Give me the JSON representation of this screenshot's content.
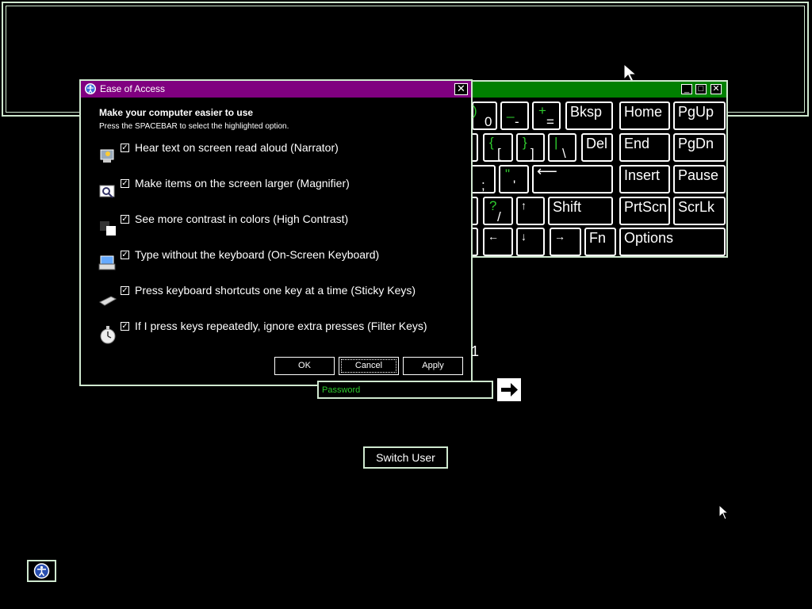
{
  "background": {
    "color": "#000000",
    "frame_color": "#cfe8cf"
  },
  "osk": {
    "title_color": "#008000",
    "controls": {
      "minimize": "_",
      "maximize": "□",
      "close": "✕"
    },
    "keys": {
      "row1": [
        {
          "id": "zero",
          "top": ")",
          "bottom": "0"
        },
        {
          "id": "minus",
          "top": "_",
          "bottom": "-"
        },
        {
          "id": "equals",
          "top": "+",
          "bottom": "="
        },
        {
          "id": "bksp",
          "label": "Bksp"
        },
        {
          "id": "home",
          "label": "Home"
        },
        {
          "id": "pgup",
          "label": "PgUp"
        }
      ],
      "row2": [
        {
          "id": "lbracket",
          "top": "{",
          "bottom": "["
        },
        {
          "id": "rbracket",
          "top": "}",
          "bottom": "]"
        },
        {
          "id": "backslash",
          "top": "|",
          "bottom": "\\"
        },
        {
          "id": "del",
          "label": "Del"
        },
        {
          "id": "end",
          "label": "End"
        },
        {
          "id": "pgdn",
          "label": "PgDn"
        }
      ],
      "row3": [
        {
          "id": "semicolon",
          "bottom": ";"
        },
        {
          "id": "quote",
          "top": "\"",
          "bottom": "'"
        },
        {
          "id": "enter",
          "label": "⟵"
        },
        {
          "id": "insert",
          "label": "Insert"
        },
        {
          "id": "pause",
          "label": "Pause"
        }
      ],
      "row4": [
        {
          "id": "slash",
          "top": "?",
          "bottom": "/"
        },
        {
          "id": "up",
          "label": "↑"
        },
        {
          "id": "shift",
          "label": "Shift"
        },
        {
          "id": "prtscn",
          "label": "PrtScn"
        },
        {
          "id": "scrlk",
          "label": "ScrLk"
        }
      ],
      "row5": [
        {
          "id": "left",
          "label": "←"
        },
        {
          "id": "down",
          "label": "↓"
        },
        {
          "id": "right",
          "label": "→"
        },
        {
          "id": "fn",
          "label": "Fn"
        },
        {
          "id": "options",
          "label": "Options"
        }
      ]
    }
  },
  "eoa_dialog": {
    "title": "Ease of Access",
    "title_color": "#800080",
    "close": "✕",
    "heading": "Make your computer easier to use",
    "subheading": "Press the SPACEBAR to select the highlighted option.",
    "options": [
      {
        "label": "Hear text on screen read aloud (Narrator)",
        "checked": true,
        "icon": "narrator-icon"
      },
      {
        "label": "Make items on the screen larger (Magnifier)",
        "checked": true,
        "icon": "magnifier-icon"
      },
      {
        "label": "See more contrast in colors (High Contrast)",
        "checked": true,
        "icon": "high-contrast-icon"
      },
      {
        "label": "Type without the keyboard (On-Screen Keyboard)",
        "checked": true,
        "icon": "on-screen-keyboard-icon"
      },
      {
        "label": "Press keyboard shortcuts one key at a time (Sticky Keys)",
        "checked": true,
        "icon": "sticky-keys-icon"
      },
      {
        "label": "If I press keys repeatedly, ignore extra presses (Filter Keys)",
        "checked": true,
        "icon": "filter-keys-icon"
      }
    ],
    "buttons": {
      "ok": "OK",
      "cancel": "Cancel",
      "apply": "Apply"
    }
  },
  "login": {
    "password_placeholder": "Password",
    "submit_icon": "arrow-right-icon",
    "switch_user": "Switch User",
    "stray_text": "1"
  },
  "ease_of_access_button_icon": "ease-of-access-icon",
  "accent_colors": {
    "green": "#2ecc2e",
    "purple": "#800080",
    "dark_green": "#008000"
  }
}
